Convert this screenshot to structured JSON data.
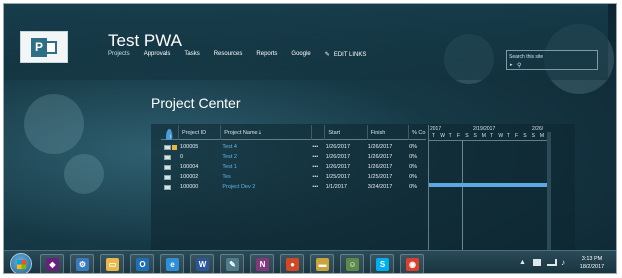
{
  "site": {
    "title": "Test PWA"
  },
  "nav": {
    "items": [
      "Projects",
      "Approvals",
      "Tasks",
      "Resources",
      "Reports",
      "Google"
    ],
    "edit_links": "EDIT LINKS"
  },
  "search": {
    "placeholder": "Search this site"
  },
  "page": {
    "title": "Project Center"
  },
  "grid": {
    "headers": {
      "id": "Project ID",
      "name": "Project Name",
      "start": "Start",
      "finish": "Finish",
      "pct": "% Co"
    },
    "rows": [
      {
        "id": "100005",
        "name": "Test 4",
        "dots": "•••",
        "start": "1/26/2017",
        "finish": "1/26/2017",
        "pct": "0%"
      },
      {
        "id": "0",
        "name": "Test 2",
        "dots": "•••",
        "start": "1/26/2017",
        "finish": "1/26/2017",
        "pct": "0%"
      },
      {
        "id": "100004",
        "name": "Test 1",
        "dots": "•••",
        "start": "1/26/2017",
        "finish": "1/26/2017",
        "pct": "0%"
      },
      {
        "id": "100002",
        "name": "Tes",
        "dots": "•••",
        "start": "1/25/2017",
        "finish": "1/25/2017",
        "pct": "0%"
      },
      {
        "id": "100000",
        "name": "Project Dev 2",
        "dots": "•••",
        "start": "1/1/2017",
        "finish": "3/24/2017",
        "pct": "0%"
      }
    ]
  },
  "gantt": {
    "dates": [
      "2017",
      "2/19/2017",
      "2/26/"
    ],
    "days": [
      "T",
      "W",
      "T",
      "F",
      "S",
      "S",
      "M",
      "T",
      "W",
      "T",
      "F",
      "S",
      "S",
      "M"
    ]
  },
  "taskbar": {
    "apps": [
      {
        "icon": "visual-studio-icon",
        "glyph": "◆",
        "color": "#68217a"
      },
      {
        "icon": "network-icon",
        "glyph": "⚙",
        "color": "#3a7bbf"
      },
      {
        "icon": "file-explorer-icon",
        "glyph": "▭",
        "color": "#e8b84a"
      },
      {
        "icon": "outlook-icon",
        "glyph": "O",
        "color": "#1f6fb5"
      },
      {
        "icon": "internet-explorer-icon",
        "glyph": "e",
        "color": "#2d8fd5"
      },
      {
        "icon": "word-icon",
        "glyph": "W",
        "color": "#2b579a"
      },
      {
        "icon": "tools-icon",
        "glyph": "✎",
        "color": "#4f7d8c"
      },
      {
        "icon": "onenote-icon",
        "glyph": "N",
        "color": "#80397b"
      },
      {
        "icon": "recorder-icon",
        "glyph": "●",
        "color": "#d24726"
      },
      {
        "icon": "folder-icon",
        "glyph": "▬",
        "color": "#c9a43a"
      },
      {
        "icon": "people-icon",
        "glyph": "☺",
        "color": "#5b8a4a"
      },
      {
        "icon": "skype-icon",
        "glyph": "S",
        "color": "#00aff0"
      },
      {
        "icon": "chrome-icon",
        "glyph": "◉",
        "color": "#d9412e"
      }
    ],
    "time": "3:13 PM",
    "date": "18/2/2017"
  }
}
